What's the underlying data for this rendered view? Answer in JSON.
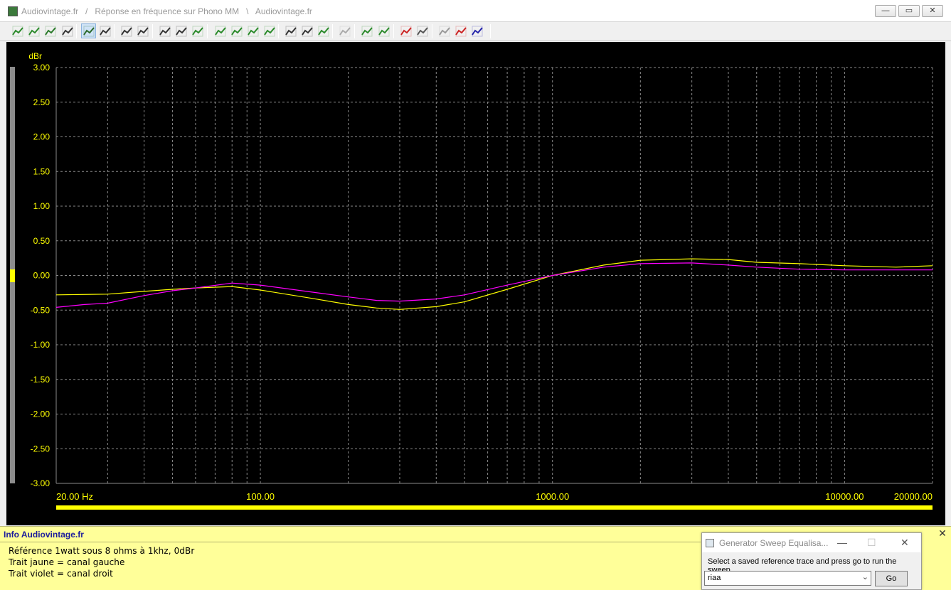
{
  "window": {
    "title": "Audiovintage.fr   /   Réponse en fréquence sur Phono MM   \\   Audiovintage.fr",
    "minimize_label": "—",
    "restore_label": "▭",
    "close_label": "✕"
  },
  "toolbar": {
    "buttons": [
      {
        "name": "add-trace-icon"
      },
      {
        "name": "trace-curve-icon"
      },
      {
        "name": "save-icon"
      },
      {
        "name": "copy-icon"
      },
      {
        "name": "graph-view-icon"
      },
      {
        "name": "print-icon"
      },
      {
        "name": "edit-icon"
      },
      {
        "name": "grid-icon"
      },
      {
        "name": "zoom-x-icon"
      },
      {
        "name": "zoom-y-icon"
      },
      {
        "name": "auto-scale-icon"
      },
      {
        "name": "trace-left-icon"
      },
      {
        "name": "trace-up-icon"
      },
      {
        "name": "trace-down-icon"
      },
      {
        "name": "trace-right-icon"
      },
      {
        "name": "zoom-in-icon"
      },
      {
        "name": "zoom-out-icon"
      },
      {
        "name": "fit-curve-icon"
      },
      {
        "name": "disabled-tool-icon"
      },
      {
        "name": "cursor-up-icon"
      },
      {
        "name": "cursor-down-icon"
      },
      {
        "name": "marker-icon"
      },
      {
        "name": "expand-icon"
      },
      {
        "name": "reference-icon"
      },
      {
        "name": "compare-icon"
      },
      {
        "name": "settings-icon"
      }
    ]
  },
  "colors": {
    "background": "#000000",
    "grid": "#8a8a8a",
    "labels": "#ffff00",
    "left_channel": "#ffff00",
    "right_channel": "#ff00ff",
    "info_background": "#ffff99",
    "info_title": "#1c1c9c"
  },
  "chart_data": {
    "type": "line",
    "x_scale": "log",
    "xlim": [
      20,
      20000
    ],
    "ylim": [
      -3.0,
      3.0
    ],
    "ylabel": "dBr",
    "xlabel": "",
    "y_ticks": [
      "3.00",
      "2.50",
      "2.00",
      "1.50",
      "1.00",
      "0.50",
      "0.00",
      "-0.50",
      "-1.00",
      "-1.50",
      "-2.00",
      "-2.50",
      "-3.00"
    ],
    "x_tick_labels": [
      {
        "value": 20,
        "label": "20.00 Hz"
      },
      {
        "value": 100,
        "label": "100.00"
      },
      {
        "value": 1000,
        "label": "1000.00"
      },
      {
        "value": 10000,
        "label": "10000.00"
      },
      {
        "value": 20000,
        "label": "20000.00"
      }
    ],
    "grid": true,
    "series": [
      {
        "color": "#ffff00",
        "x": [
          20,
          30,
          40,
          50,
          60,
          80,
          100,
          150,
          200,
          250,
          300,
          400,
          500,
          700,
          1000,
          1500,
          2000,
          3000,
          4000,
          5000,
          7000,
          10000,
          15000,
          20000
        ],
        "y": [
          -0.28,
          -0.27,
          -0.23,
          -0.2,
          -0.18,
          -0.16,
          -0.21,
          -0.33,
          -0.42,
          -0.47,
          -0.49,
          -0.45,
          -0.38,
          -0.2,
          0.0,
          0.15,
          0.22,
          0.24,
          0.23,
          0.19,
          0.17,
          0.14,
          0.12,
          0.14
        ]
      },
      {
        "color": "#ff00ff",
        "x": [
          20,
          25,
          30,
          40,
          50,
          60,
          80,
          100,
          150,
          200,
          250,
          300,
          400,
          500,
          700,
          1000,
          1500,
          2000,
          3000,
          4000,
          5000,
          7000,
          10000,
          15000,
          20000
        ],
        "y": [
          -0.46,
          -0.42,
          -0.4,
          -0.29,
          -0.22,
          -0.18,
          -0.11,
          -0.14,
          -0.24,
          -0.31,
          -0.36,
          -0.37,
          -0.34,
          -0.28,
          -0.14,
          0.0,
          0.12,
          0.17,
          0.18,
          0.15,
          0.12,
          0.09,
          0.08,
          0.08,
          0.08
        ]
      }
    ]
  },
  "info": {
    "title": "Info Audiovintage.fr",
    "lines": [
      "Référence 1watt sous 8 ohms à 1khz, 0dBr",
      "Trait jaune = canal gauche",
      "Trait violet = canal droit"
    ],
    "close_label": "✕"
  },
  "generator": {
    "title": "Generator Sweep Equalisa...",
    "prompt": "Select a saved reference trace and press go to run the sweep",
    "selected": "riaa",
    "go_label": "Go",
    "min_label": "—",
    "max_label": "☐",
    "close_label": "✕"
  }
}
